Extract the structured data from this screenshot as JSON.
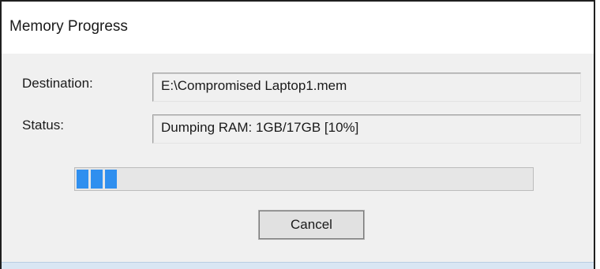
{
  "window": {
    "title": "Memory Progress"
  },
  "form": {
    "destination_label": "Destination:",
    "destination_value": "E:\\Compromised Laptop1.mem",
    "status_label": "Status:",
    "status_value": "Dumping RAM: 1GB/17GB [10%]"
  },
  "progress": {
    "percent": 10
  },
  "buttons": {
    "cancel_label": "Cancel"
  },
  "colors": {
    "progress_fill": "#2f8fef"
  }
}
